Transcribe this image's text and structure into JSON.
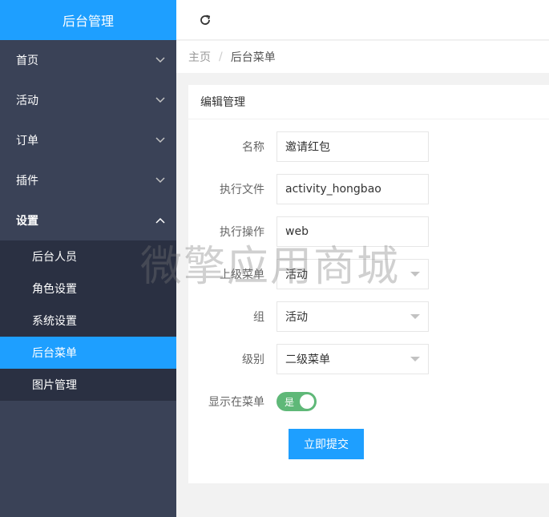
{
  "sidebar": {
    "title": "后台管理",
    "items": [
      {
        "label": "首页"
      },
      {
        "label": "活动"
      },
      {
        "label": "订单"
      },
      {
        "label": "插件"
      },
      {
        "label": "设置"
      }
    ],
    "settings_children": [
      {
        "label": "后台人员"
      },
      {
        "label": "角色设置"
      },
      {
        "label": "系统设置"
      },
      {
        "label": "后台菜单"
      },
      {
        "label": "图片管理"
      }
    ]
  },
  "breadcrumb": {
    "home": "主页",
    "separator": "/",
    "current": "后台菜单"
  },
  "panel": {
    "title": "编辑管理"
  },
  "form": {
    "name_label": "名称",
    "name_value": "邀请红包",
    "file_label": "执行文件",
    "file_value": "activity_hongbao",
    "action_label": "执行操作",
    "action_value": "web",
    "parent_label": "上级菜单",
    "parent_value": "活动",
    "group_label": "组",
    "group_value": "活动",
    "level_label": "级别",
    "level_value": "二级菜单",
    "show_label": "显示在菜单",
    "show_toggle_text": "是",
    "submit_label": "立即提交"
  },
  "watermark": "微擎应用商城",
  "colors": {
    "accent": "#1e9fff",
    "sidebar_bg": "#3a4257",
    "submenu_bg": "#2a3042",
    "toggle_on": "#5fb878"
  }
}
